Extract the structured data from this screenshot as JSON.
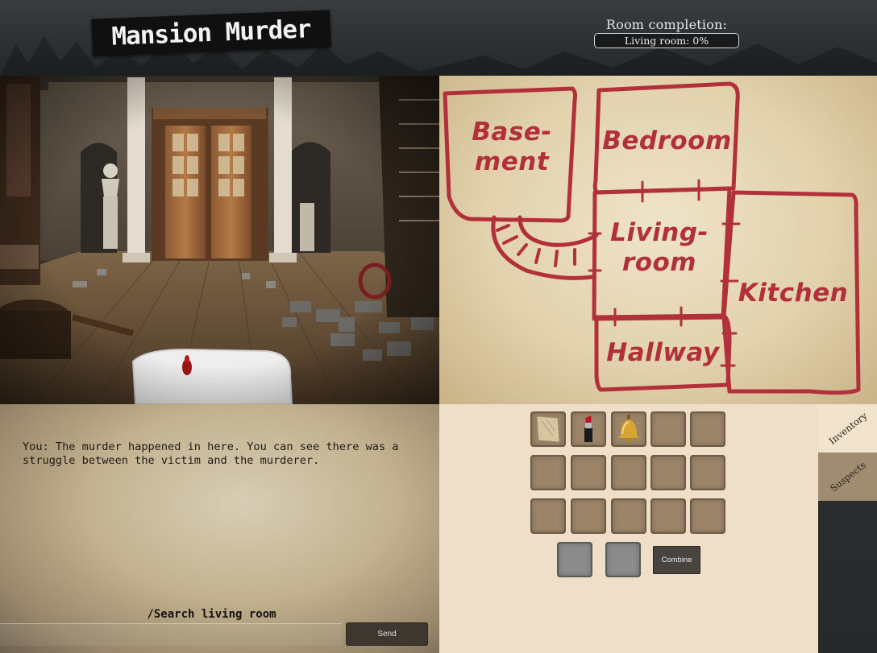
{
  "header": {
    "title": "Mansion Murder",
    "completion_label": "Room completion:",
    "completion_text": "Living room: 0%",
    "completion_value": 0
  },
  "map": {
    "rooms": [
      {
        "name": "basement",
        "label": "Base-\nment"
      },
      {
        "name": "bedroom",
        "label": "Bedroom"
      },
      {
        "name": "living-room",
        "label": "Living-\nroom"
      },
      {
        "name": "kitchen",
        "label": "Kitchen"
      },
      {
        "name": "hallway",
        "label": "Hallway"
      }
    ]
  },
  "narrative": {
    "text": "You: The murder happened in here. You can see there was a struggle between the victim and the murderer."
  },
  "command": {
    "hint": "/Search living room",
    "input_value": "",
    "send_label": "Send"
  },
  "inventory": {
    "slots": [
      "paper",
      "lipstick",
      "bell",
      "",
      "",
      "",
      "",
      "",
      "",
      "",
      "",
      "",
      "",
      "",
      ""
    ],
    "combine_label": "Combine"
  },
  "tabs": {
    "inventory": "Inventory",
    "suspects": "Suspects"
  },
  "colors": {
    "map_ink": "#b2303a",
    "slot": "#9b8468",
    "panel": "#efdfc8"
  }
}
